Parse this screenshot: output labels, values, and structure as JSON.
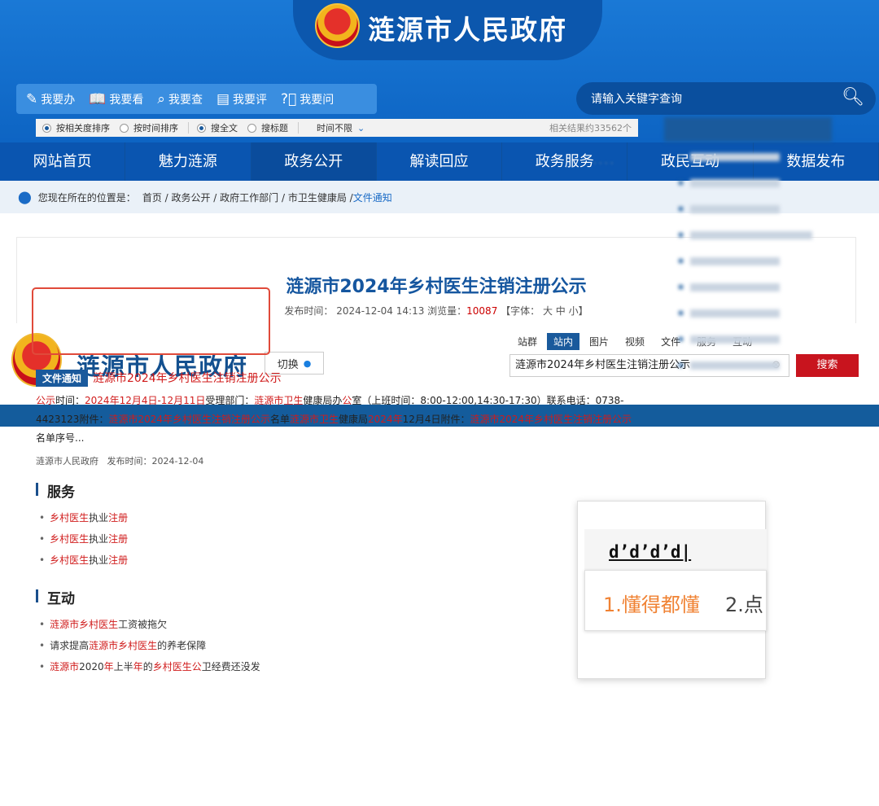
{
  "banner": {
    "site_title": "涟源市人民政府",
    "quick_links": [
      {
        "icon": "edit-icon",
        "label": "我要办"
      },
      {
        "icon": "book-icon",
        "label": "我要看"
      },
      {
        "icon": "search-icon",
        "label": "我要查"
      },
      {
        "icon": "comment-icon",
        "label": "我要评"
      },
      {
        "icon": "question-icon",
        "label": "我要问"
      }
    ],
    "search_placeholder": "请输入关键字查询"
  },
  "nav": {
    "items": [
      "网站首页",
      "魅力涟源",
      "政务公开",
      "解读回应",
      "政务服务",
      "政民互动",
      "数据发布"
    ],
    "active": "政务公开"
  },
  "breadcrumb": {
    "prefix": "您现在所在的位置是：",
    "trail": "首页 / 政务公开 / 政府工作部门 / 市卫生健康局 / ",
    "current": "文件通知"
  },
  "article": {
    "title": "涟源市2024年乡村医生注销注册公示",
    "meta_prefix": "发布时间： 2024-12-04 14:13    浏览量：",
    "views": "10087",
    "font_ctrl": "    【字体： 大 中 小】"
  },
  "search_page": {
    "site_title": "涟源市人民政府",
    "switch_label": "切换",
    "categories": [
      "站群",
      "站内",
      "图片",
      "视频",
      "文件",
      "服务",
      "互动"
    ],
    "active_category": "站内",
    "query": "涟源市2024年乡村医生注销注册公示",
    "search_button": "搜索",
    "filter": {
      "sort_relevance": "按相关度排序",
      "sort_time": "按时间排序",
      "full_text": "搜全文",
      "title_only": "搜标题",
      "time_range": "时间不限",
      "result_count": "相关结果约33562个"
    },
    "sections": {
      "service": "服务",
      "interaction": "互动"
    },
    "service_results": [
      {
        "a": "乡村医生",
        "b": "执业",
        "c": "注册"
      },
      {
        "a": "乡村医生",
        "b": "执业",
        "c": "注册"
      },
      {
        "a": "乡村医生",
        "b": "执业",
        "c": "注册"
      }
    ],
    "interaction_results": [
      {
        "p1": "涟源市乡村医生",
        "p2": "工资被拖欠",
        "p3": "",
        "p4": ""
      },
      {
        "p1": "",
        "p2": "请求提高",
        "p3": "涟源市乡村医生",
        "p4": "的养老保障"
      },
      {
        "p1": "涟源市",
        "p2": "2020",
        "p3": "年",
        "p4": "上半"
      }
    ],
    "third_tail": {
      "a": "年",
      "b": "的",
      "c": "乡村医生公",
      "d": "卫经费还没发"
    },
    "document": {
      "tag": "文件通知",
      "title": "涟源市2024年乡村医生注销注册公示",
      "body_parts": [
        {
          "t": "公示",
          "r": true
        },
        {
          "t": "时间：",
          "r": false
        },
        {
          "t": "2024年12月4日-12月11日",
          "r": true
        },
        {
          "t": "受理部门：",
          "r": false
        },
        {
          "t": "涟源市卫生",
          "r": true
        },
        {
          "t": "健康局办",
          "r": false
        },
        {
          "t": "公",
          "r": true
        },
        {
          "t": "室（上班时间：8:00-12:00,14:30-17:30）联系电话：0738-4423123附件：",
          "r": false
        },
        {
          "t": "涟源市2024年乡村医生注销注册公示",
          "r": true
        },
        {
          "t": "名单",
          "r": false
        },
        {
          "t": "涟源市卫生",
          "r": true
        },
        {
          "t": "健康局",
          "r": false
        },
        {
          "t": "2024年",
          "r": true
        },
        {
          "t": "12月4日附件：",
          "r": false
        },
        {
          "t": "涟源市2024年乡村医生注销注册公示",
          "r": true
        },
        {
          "t": "名单序号...",
          "r": false
        }
      ],
      "source": "涟源市人民政府",
      "date_label": "发布时间：",
      "date": "2024-12-04"
    }
  },
  "ime": {
    "composition": "d’d’d’d|",
    "candidate1": "1.懂得都懂",
    "candidate2": "2.点"
  },
  "colors": {
    "banner_blue": "#0b62c0",
    "nav_blue": "#0a55b0",
    "title_blue": "#15569f",
    "highlight_red": "#d01b1b",
    "search_button_red": "#c8141e",
    "ime_candidate_orange": "#f08233"
  }
}
